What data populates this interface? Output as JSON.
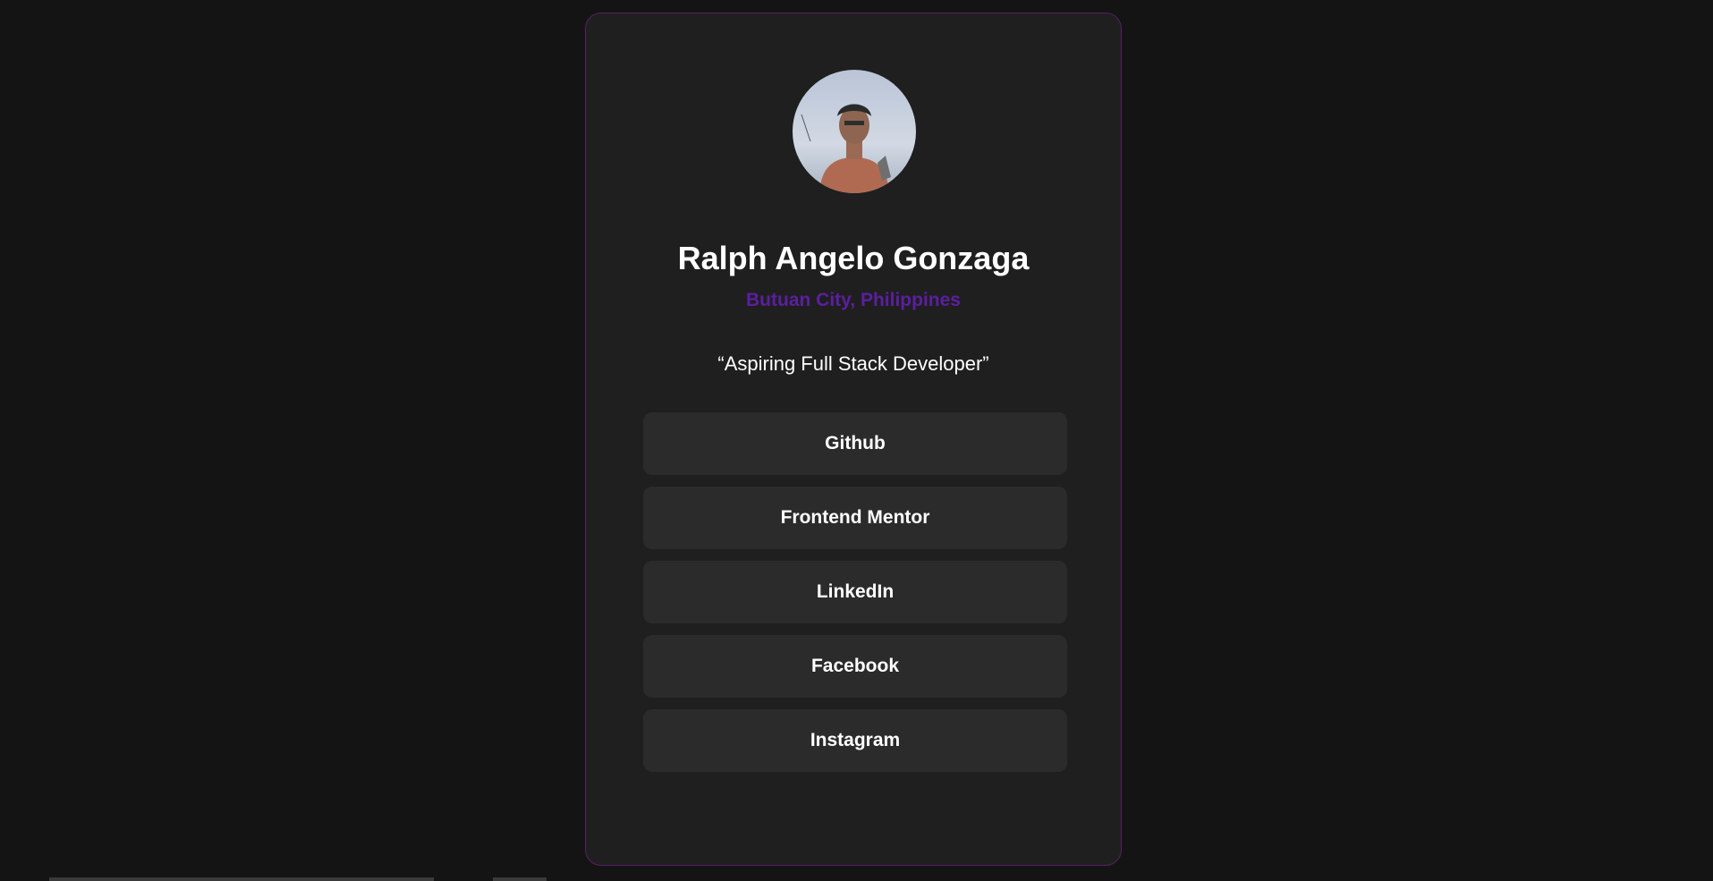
{
  "profile": {
    "name": "Ralph Angelo Gonzaga",
    "location": "Butuan City, Philippines",
    "bio": "“Aspiring Full Stack Developer”"
  },
  "links": [
    {
      "label": "Github"
    },
    {
      "label": "Frontend Mentor"
    },
    {
      "label": "LinkedIn"
    },
    {
      "label": "Facebook"
    },
    {
      "label": "Instagram"
    }
  ],
  "colors": {
    "page_background": "#141414",
    "card_background": "#1f1f1f",
    "card_border": "#5a1f66",
    "accent": "#5b1fa0",
    "button_background": "#2b2b2b",
    "text": "#ffffff"
  }
}
